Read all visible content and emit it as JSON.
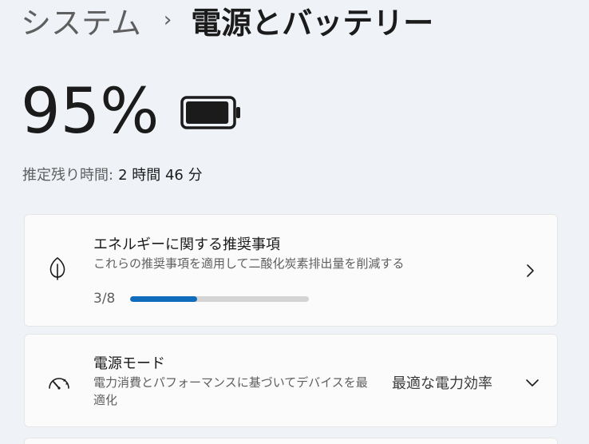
{
  "breadcrumb": {
    "parent": "システム",
    "separator": "›",
    "current": "電源とバッテリー"
  },
  "battery": {
    "percent_text": "95%",
    "level": 0.95,
    "estimate_label": "推定残り時間:",
    "estimate_value": "2 時間 46 分"
  },
  "recommendations": {
    "title": "エネルギーに関する推奨事項",
    "description": "これらの推奨事項を適用して二酸化炭素排出量を削減する",
    "progress_text": "3/8",
    "progress_fraction": 0.375,
    "icon": "leaf-icon"
  },
  "power_mode": {
    "title": "電源モード",
    "description": "電力消費とパフォーマンスに基づいてデバイスを最適化",
    "value": "最適な電力効率",
    "icon": "speedometer-icon"
  },
  "colors": {
    "accent": "#0f6cbd",
    "background": "#eff3f8",
    "card": "#fbfbfb"
  }
}
